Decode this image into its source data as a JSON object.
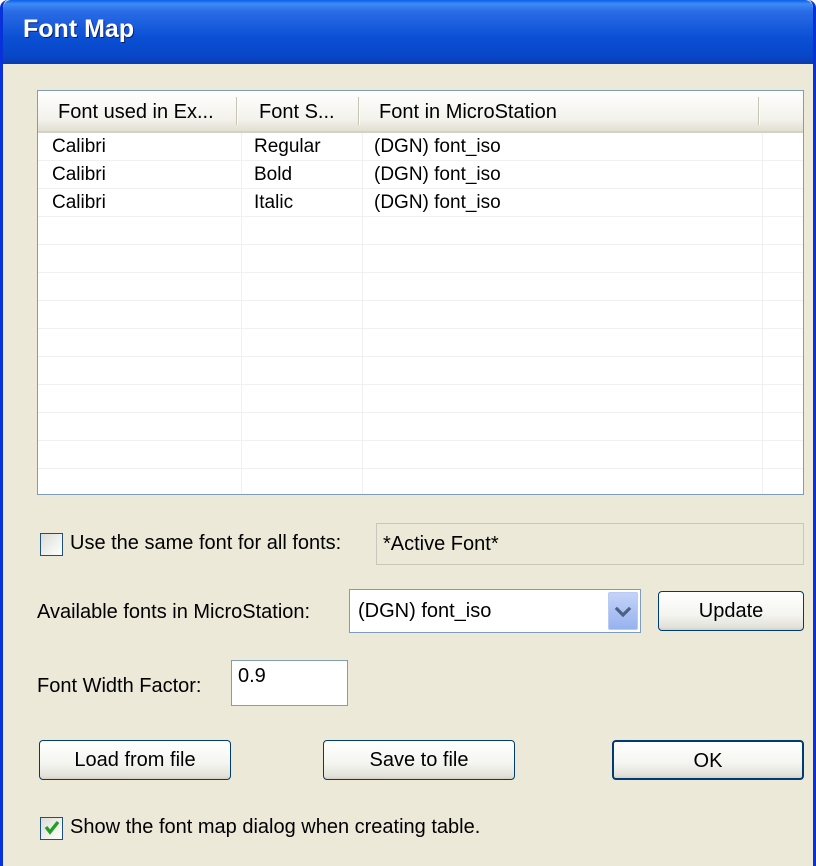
{
  "window": {
    "title": "Font Map"
  },
  "font_list": {
    "columns": [
      "Font used in Ex...",
      "Font S...",
      "Font in MicroStation"
    ],
    "rows": [
      [
        "Calibri",
        "Regular",
        "(DGN) font_iso"
      ],
      [
        "Calibri",
        "Bold",
        "(DGN) font_iso"
      ],
      [
        "Calibri",
        "Italic",
        "(DGN) font_iso"
      ]
    ]
  },
  "same_font": {
    "label": "Use the same font for all fonts:",
    "checked": false,
    "value": "*Active Font*"
  },
  "available_fonts": {
    "label": "Available fonts in MicroStation:",
    "selected": "(DGN) font_iso",
    "update_label": "Update"
  },
  "width_factor": {
    "label": "Font Width Factor:",
    "value": "0.9"
  },
  "buttons": {
    "load": "Load from file",
    "save": "Save to file",
    "ok": "OK"
  },
  "show_dialog": {
    "label": "Show the font map dialog when creating table.",
    "checked": true
  },
  "colors": {
    "titlebar": "#0A4FD4",
    "dialog_bg": "#ECE9D8",
    "control_border": "#7F9DB9"
  }
}
